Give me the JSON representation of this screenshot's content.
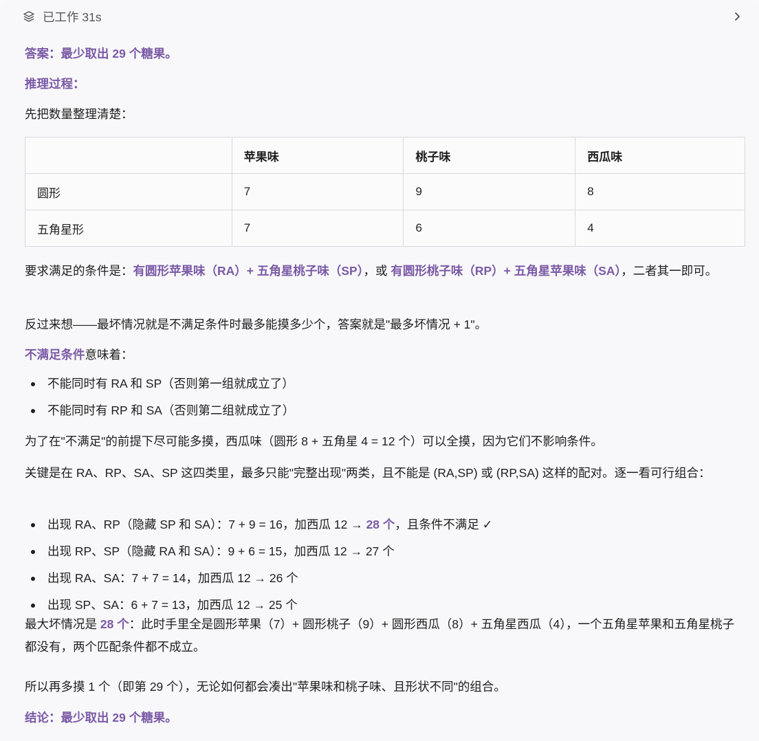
{
  "header": {
    "worked_label": "已工作 31s"
  },
  "answer": {
    "label": "答案：最少取出 29 个糖果。"
  },
  "reasoning": {
    "label": "推理过程："
  },
  "intro": "先把数量整理清楚：",
  "table": {
    "headers": [
      "",
      "苹果味",
      "桃子味",
      "西瓜味"
    ],
    "rows": [
      [
        "圆形",
        "7",
        "9",
        "8"
      ],
      [
        "五角星形",
        "7",
        "6",
        "4"
      ]
    ]
  },
  "requirement": {
    "prefix": "要求满足的条件是：",
    "group1": "有圆形苹果味（RA）+ 五角星桃子味（SP）",
    "sep": "，或 ",
    "group2": "有圆形桃子味（RP）+ 五角星苹果味（SA）",
    "suffix": "，二者其一即可。"
  },
  "reverse": "反过来想——最坏情况就是不满足条件时最多能摸多少个，答案就是\"最多坏情况 + 1\"。",
  "not_satisfied": {
    "label": "不满足条件",
    "suffix": "意味着："
  },
  "bullets1": [
    "不能同时有 RA 和 SP（否则第一组就成立了）",
    "不能同时有 RP 和 SA（否则第二组就成立了）"
  ],
  "watermelon": "为了在\"不满足\"的前提下尽可能多摸，西瓜味（圆形 8 + 五角星 4 = 12 个）可以全摸，因为它们不影响条件。",
  "key": "关键是在 RA、RP、SA、SP 这四类里，最多只能\"完整出现\"两类，且不能是 (RA,SP) 或 (RP,SA) 这样的配对。逐一看可行组合：",
  "bullets2": [
    {
      "text": "出现 RA、RP（隐藏 SP 和 SA）：7 + 9 = 16，加西瓜 12 → ",
      "highlight": "28 个",
      "tail": "，且条件不满足 ✓"
    },
    {
      "text": "出现 RP、SP（隐藏 RA 和 SA）：9 + 6 = 15，加西瓜 12 → 27 个",
      "highlight": "",
      "tail": ""
    },
    {
      "text": "出现 RA、SA：7 + 7 = 14，加西瓜 12 → 26 个",
      "highlight": "",
      "tail": ""
    },
    {
      "text": "出现 SP、SA：6 + 7 = 13，加西瓜 12 → 25 个",
      "highlight": "",
      "tail": ""
    }
  ],
  "max_case": {
    "prefix": "最大坏情况是 ",
    "highlight": "28 个",
    "suffix": "：此时手里全是圆形苹果（7）+ 圆形桃子（9）+ 圆形西瓜（8）+ 五角星西瓜（4），一个五角星苹果和五角星桃子都没有，两个匹配条件都不成立。"
  },
  "so": "所以再多摸 1 个（即第 29 个），无论如何都会凑出\"苹果味和桃子味、且形状不同\"的组合。",
  "conclusion": "结论：最少取出 29 个糖果。",
  "colors": {
    "accent": "#7b5aa6",
    "text": "#1f1f1f",
    "background": "#f8f8fa"
  }
}
